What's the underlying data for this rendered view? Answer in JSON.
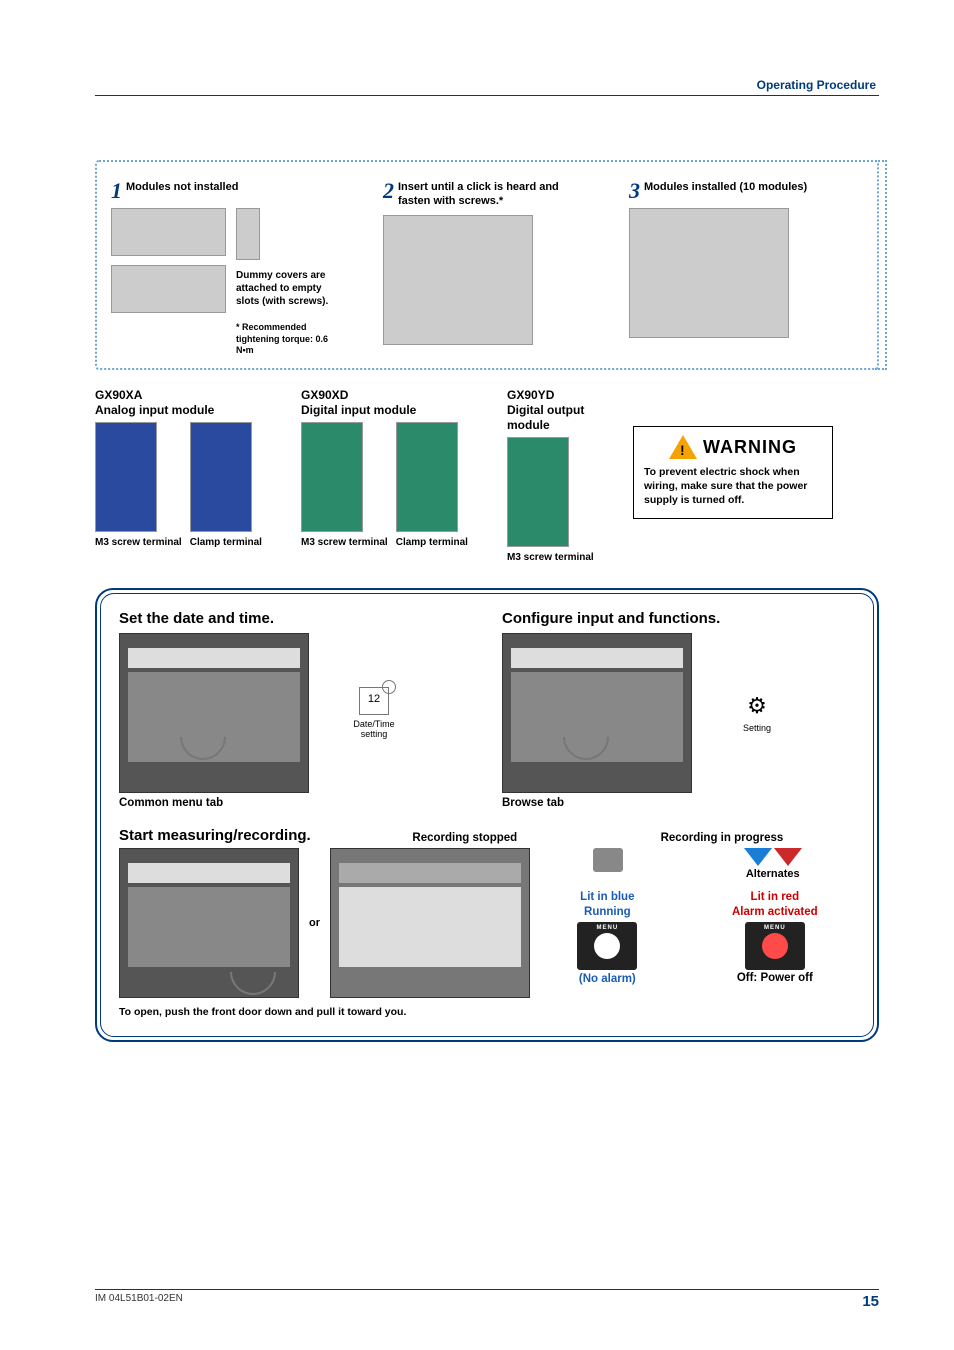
{
  "header": {
    "section": "Operating Procedure"
  },
  "steps": {
    "s1": {
      "num": "1",
      "title": "Modules not installed",
      "dummy_note": "Dummy covers are attached to empty slots (with screws).",
      "torque_note": "* Recommended tightening torque: 0.6 N•m"
    },
    "s2": {
      "num": "2",
      "title": "Insert until a click is heard and fasten with screws.*"
    },
    "s3": {
      "num": "3",
      "title": "Modules installed (10 modules)"
    }
  },
  "modules": {
    "m1": {
      "code": "GX90XA",
      "name": "Analog input module",
      "cap1": "M3 screw terminal",
      "cap2": "Clamp terminal"
    },
    "m2": {
      "code": "GX90XD",
      "name": "Digital input module",
      "cap1": "M3 screw terminal",
      "cap2": "Clamp terminal"
    },
    "m3": {
      "code": "GX90YD",
      "name": "Digital output module",
      "cap1": "M3 screw terminal"
    }
  },
  "warning": {
    "word": "WARNING",
    "text": "To prevent electric shock when wiring, make sure that the power supply is turned off."
  },
  "panel": {
    "sec1": {
      "title": "Set the date and time.",
      "icon_cap": "Date/Time setting",
      "caption": "Common menu tab"
    },
    "sec2": {
      "title": "Configure input and functions.",
      "icon_cap": "Setting",
      "caption": "Browse tab"
    },
    "sec3": {
      "title": "Start measuring/recording.",
      "or": "or",
      "rec_stop": "Recording stopped",
      "rec_prog": "Recording in progress",
      "alternates": "Alternates",
      "blue1": "Lit in blue",
      "blue2": "Running",
      "no_alarm": "(No alarm)",
      "red1": "Lit in red",
      "red2": "Alarm activated",
      "off": "Off: Power off",
      "menu_label": "MENU",
      "foot": "To open, push the front door down and pull it toward you."
    }
  },
  "footer": {
    "doc": "IM 04L51B01-02EN",
    "page": "15"
  },
  "icons": {
    "calendar": "12"
  }
}
